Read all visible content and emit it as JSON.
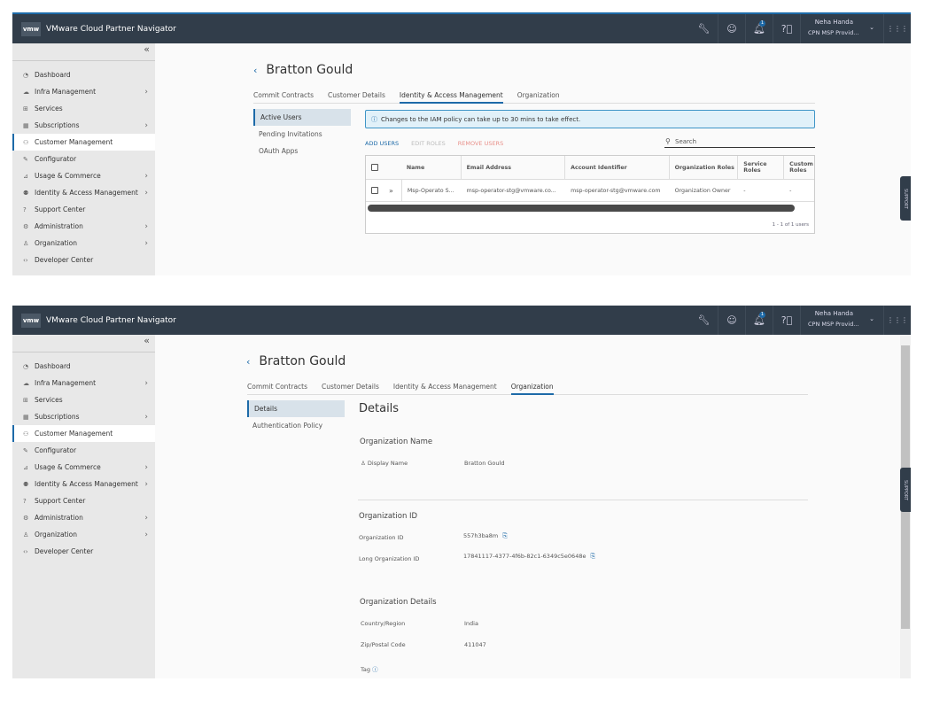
{
  "header": {
    "logo": "vmw",
    "title": "VMware Cloud Partner Navigator",
    "user_name": "Neha Handa",
    "user_org": "CPN MSP Provid...",
    "notification_count": "1",
    "icons": [
      "wrench-icon",
      "smiley-icon",
      "bell-icon",
      "help-icon"
    ]
  },
  "sidebar": {
    "collapse": "«",
    "items": [
      {
        "label": "Dashboard",
        "icon": "◔",
        "chev": false
      },
      {
        "label": "Infra Management",
        "icon": "☁",
        "chev": true
      },
      {
        "label": "Services",
        "icon": "⊞",
        "chev": false
      },
      {
        "label": "Subscriptions",
        "icon": "▦",
        "chev": true
      },
      {
        "label": "Customer Management",
        "icon": "⚇",
        "chev": false,
        "active": true
      },
      {
        "label": "Configurator",
        "icon": "✎",
        "chev": false
      },
      {
        "label": "Usage & Commerce",
        "icon": "⊿",
        "chev": true
      },
      {
        "label": "Identity & Access Management",
        "icon": "⚉",
        "chev": true
      },
      {
        "label": "Support Center",
        "icon": "?",
        "chev": false
      },
      {
        "label": "Administration",
        "icon": "⚙",
        "chev": true
      },
      {
        "label": "Organization",
        "icon": "♙",
        "chev": true
      },
      {
        "label": "Developer Center",
        "icon": "‹›",
        "chev": false
      }
    ]
  },
  "support_label": "SUPPORT",
  "customer_name": "Bratton Gould",
  "tabs": [
    "Commit Contracts",
    "Customer Details",
    "Identity & Access Management",
    "Organization"
  ],
  "iam": {
    "subnav": [
      "Active Users",
      "Pending Invitations",
      "OAuth Apps"
    ],
    "alert": "Changes to the IAM policy can take up to 30 mins to take effect.",
    "actions": {
      "add": "ADD USERS",
      "edit": "EDIT ROLES",
      "remove": "REMOVE USERS"
    },
    "search_placeholder": "Search",
    "columns": [
      "Name",
      "Email Address",
      "Account Identifier",
      "Organization Roles",
      "Service Roles",
      "Custom Roles"
    ],
    "rows": [
      [
        "Msp-Operato S...",
        "msp-operator-stg@vmware.co...",
        "msp-operator-stg@vmware.com",
        "Organization Owner",
        "-",
        "-"
      ]
    ],
    "footer": "1 - 1 of 1 users"
  },
  "org": {
    "subnav": [
      "Details",
      "Authentication Policy"
    ],
    "heading": "Details",
    "name_section": "Organization Name",
    "display_name_label": "Display Name",
    "display_name": "Bratton Gould",
    "id_section": "Organization ID",
    "org_id_label": "Organization ID",
    "org_id": "557h3ba8m",
    "long_id_label": "Long Organization ID",
    "long_id": "17841117-4377-4f6b-82c1-6349c5e0648e",
    "details_section": "Organization Details",
    "country_label": "Country/Region",
    "country": "India",
    "zip_label": "Zip/Postal Code",
    "zip": "411047",
    "tag_label": "Tag"
  },
  "colors": {
    "accent": "#1d6aa8",
    "header": "#313d4a",
    "remove": "#e8908a"
  }
}
